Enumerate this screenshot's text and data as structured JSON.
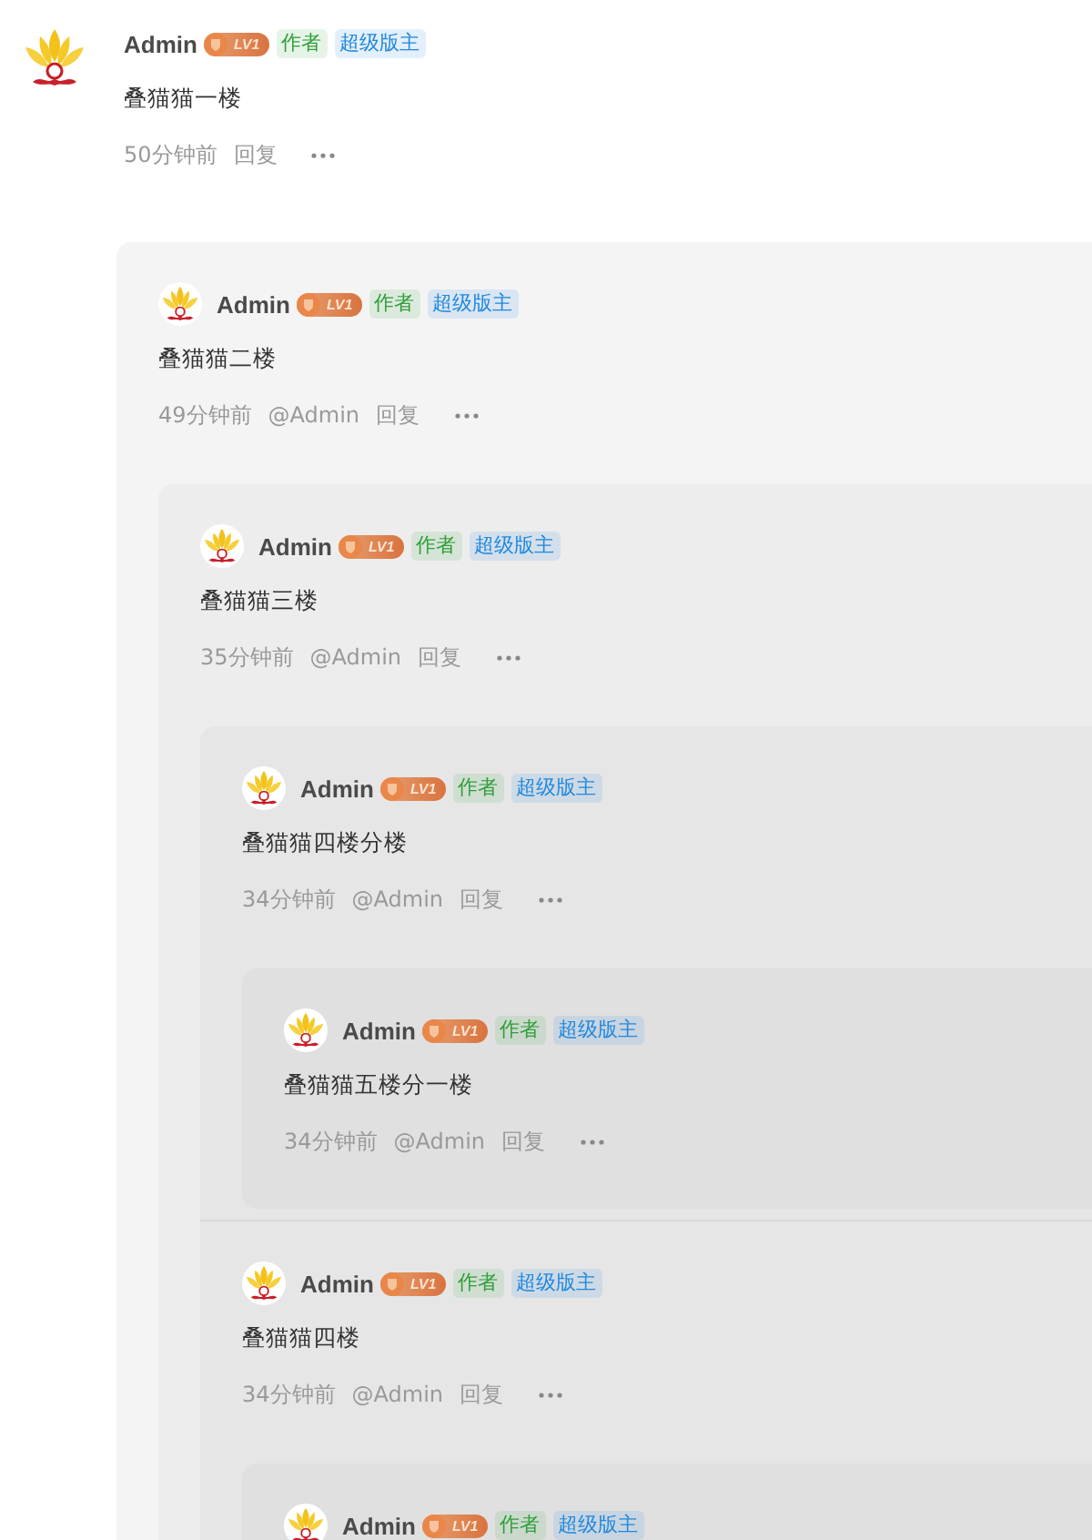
{
  "comments": [
    {
      "author": "Admin",
      "level_badge": "LV1",
      "tags": [
        {
          "label": "作者",
          "kind": "author"
        },
        {
          "label": "超级版主",
          "kind": "moderator"
        }
      ],
      "content": "叠猫猫一楼",
      "time": "50分钟前",
      "reply": "回复",
      "replies": [
        {
          "author": "Admin",
          "level_badge": "LV1",
          "tags": [
            {
              "label": "作者",
              "kind": "author"
            },
            {
              "label": "超级版主",
              "kind": "moderator"
            }
          ],
          "content": "叠猫猫二楼",
          "time": "49分钟前",
          "mention": "@Admin",
          "reply": "回复",
          "replies": [
            {
              "author": "Admin",
              "level_badge": "LV1",
              "tags": [
                {
                  "label": "作者",
                  "kind": "author"
                },
                {
                  "label": "超级版主",
                  "kind": "moderator"
                }
              ],
              "content": "叠猫猫三楼",
              "time": "35分钟前",
              "mention": "@Admin",
              "reply": "回复",
              "replies": [
                {
                  "author": "Admin",
                  "level_badge": "LV1",
                  "tags": [
                    {
                      "label": "作者",
                      "kind": "author"
                    },
                    {
                      "label": "超级版主",
                      "kind": "moderator"
                    }
                  ],
                  "content": "叠猫猫四楼分楼",
                  "time": "34分钟前",
                  "mention": "@Admin",
                  "reply": "回复",
                  "replies": [
                    {
                      "author": "Admin",
                      "level_badge": "LV1",
                      "tags": [
                        {
                          "label": "作者",
                          "kind": "author"
                        },
                        {
                          "label": "超级版主",
                          "kind": "moderator"
                        }
                      ],
                      "content": "叠猫猫五楼分一楼",
                      "time": "34分钟前",
                      "mention": "@Admin",
                      "reply": "回复"
                    }
                  ]
                },
                {
                  "author": "Admin",
                  "level_badge": "LV1",
                  "tags": [
                    {
                      "label": "作者",
                      "kind": "author"
                    },
                    {
                      "label": "超级版主",
                      "kind": "moderator"
                    }
                  ],
                  "content": "叠猫猫四楼",
                  "time": "34分钟前",
                  "mention": "@Admin",
                  "reply": "回复",
                  "replies": [
                    {
                      "author": "Admin",
                      "level_badge": "LV1",
                      "tags": [
                        {
                          "label": "作者",
                          "kind": "author"
                        },
                        {
                          "label": "超级版主",
                          "kind": "moderator"
                        }
                      ]
                    }
                  ]
                }
              ]
            }
          ]
        }
      ]
    }
  ]
}
